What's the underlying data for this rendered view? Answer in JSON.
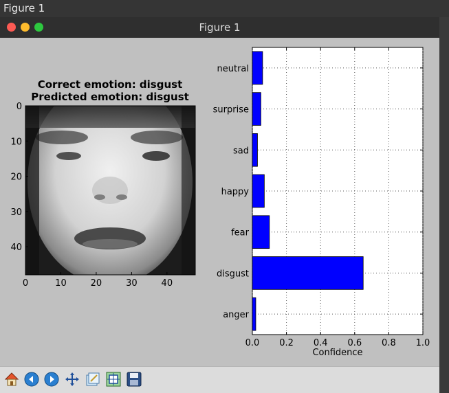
{
  "window": {
    "outer_title": "Figure 1",
    "title": "Figure 1"
  },
  "image_panel": {
    "title_line1": "Correct emotion: disgust",
    "title_line2": "Predicted emotion: disgust",
    "x_ticks": [
      "0",
      "10",
      "20",
      "30",
      "40"
    ],
    "y_ticks": [
      "0",
      "10",
      "20",
      "30",
      "40"
    ]
  },
  "chart_data": {
    "type": "bar",
    "orientation": "horizontal",
    "categories": [
      "anger",
      "disgust",
      "fear",
      "happy",
      "sad",
      "surprise",
      "neutral"
    ],
    "values": [
      0.02,
      0.65,
      0.1,
      0.07,
      0.03,
      0.05,
      0.06
    ],
    "xlabel": "Confidence",
    "xlim": [
      0.0,
      1.0
    ],
    "x_ticks": [
      "0.0",
      "0.2",
      "0.4",
      "0.6",
      "0.8",
      "1.0"
    ],
    "grid": true,
    "bar_color": "#0000ff"
  },
  "toolbar": {
    "icons": [
      "home-icon",
      "back-icon",
      "forward-icon",
      "pan-icon",
      "configure-subplots-icon",
      "zoom-icon",
      "save-icon"
    ]
  }
}
